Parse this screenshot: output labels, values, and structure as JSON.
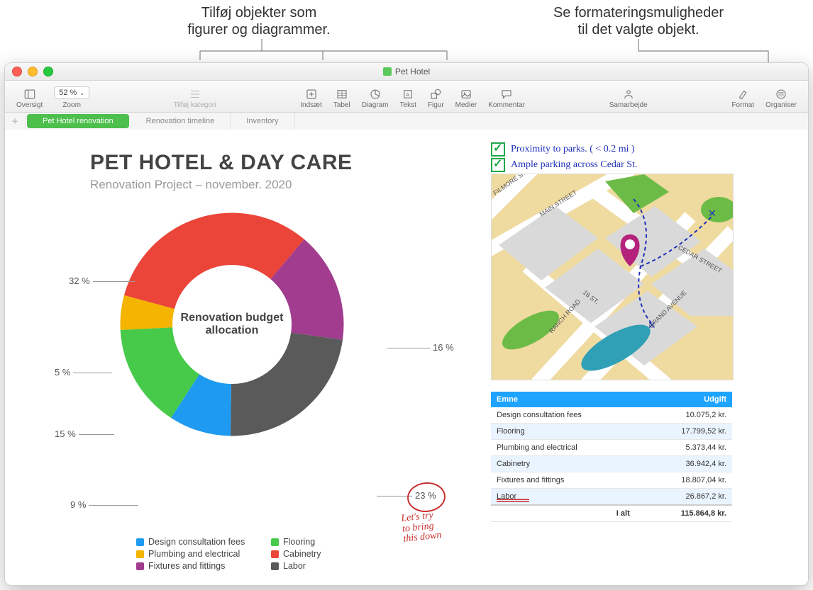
{
  "callouts": {
    "left": "Tilføj objekter som\nfigurer og diagrammer.",
    "right": "Se formateringsmuligheder\ntil det valgte objekt."
  },
  "window_title": "Pet Hotel",
  "toolbar": {
    "oversigt": "Oversigt",
    "zoom_value": "52 %",
    "zoom_label": "Zoom",
    "tilfoj_kategori": "Tilføj kategori",
    "indsaet": "Indsæt",
    "tabel": "Tabel",
    "diagram": "Diagram",
    "tekst": "Tekst",
    "figur": "Figur",
    "medier": "Medier",
    "kommentar": "Kommentar",
    "samarbejde": "Samarbejde",
    "format": "Format",
    "organiser": "Organiser"
  },
  "sheets": {
    "active": "Pet Hotel renovation",
    "t2": "Renovation timeline",
    "t3": "Inventory"
  },
  "doc": {
    "title": "PET HOTEL & DAY CARE",
    "subtitle": "Renovation Project – november. 2020",
    "chart_center": "Renovation budget allocation"
  },
  "notes": {
    "n1": "Proximity to parks. ( < 0.2 mi )",
    "n2": "Ample parking across  Cedar St."
  },
  "map_labels": {
    "filmore": "FILMORE ST.",
    "main": "MAIN STREET",
    "cedar": "CEDAR STREET",
    "ranch": "RANCH ROAD",
    "grand": "GRAND AVENUE",
    "eighteen": "18 ST."
  },
  "annotation": "Let's try\nto bring\nthis down",
  "chart_data": {
    "type": "pie",
    "title": "Renovation budget allocation",
    "series": [
      {
        "name": "Design consultation fees",
        "value": 9,
        "color": "#1e9bf0",
        "label": "9 %"
      },
      {
        "name": "Flooring",
        "value": 15,
        "color": "#47c94a",
        "label": "15 %"
      },
      {
        "name": "Plumbing and electrical",
        "value": 5,
        "color": "#f4b400",
        "label": "5 %"
      },
      {
        "name": "Cabinetry",
        "value": 32,
        "color": "#eb4438",
        "label": "32 %"
      },
      {
        "name": "Fixtures and fittings",
        "value": 16,
        "color": "#a13c8f",
        "label": "16 %"
      },
      {
        "name": "Labor",
        "value": 23,
        "color": "#5a5a5a",
        "label": "23 %"
      }
    ]
  },
  "table": {
    "h1": "Emne",
    "h2": "Udgift",
    "rows": [
      {
        "n": "Design consultation fees",
        "v": "10.075,2 kr."
      },
      {
        "n": "Flooring",
        "v": "17.799,52 kr."
      },
      {
        "n": "Plumbing and electrical",
        "v": "5.373,44 kr."
      },
      {
        "n": "Cabinetry",
        "v": "36.942,4 kr."
      },
      {
        "n": "Fixtures and fittings",
        "v": "18.807,04 kr."
      },
      {
        "n": "Labor",
        "v": "26.867,2 kr."
      }
    ],
    "total_label": "I alt",
    "total_value": "115.864,8 kr."
  }
}
